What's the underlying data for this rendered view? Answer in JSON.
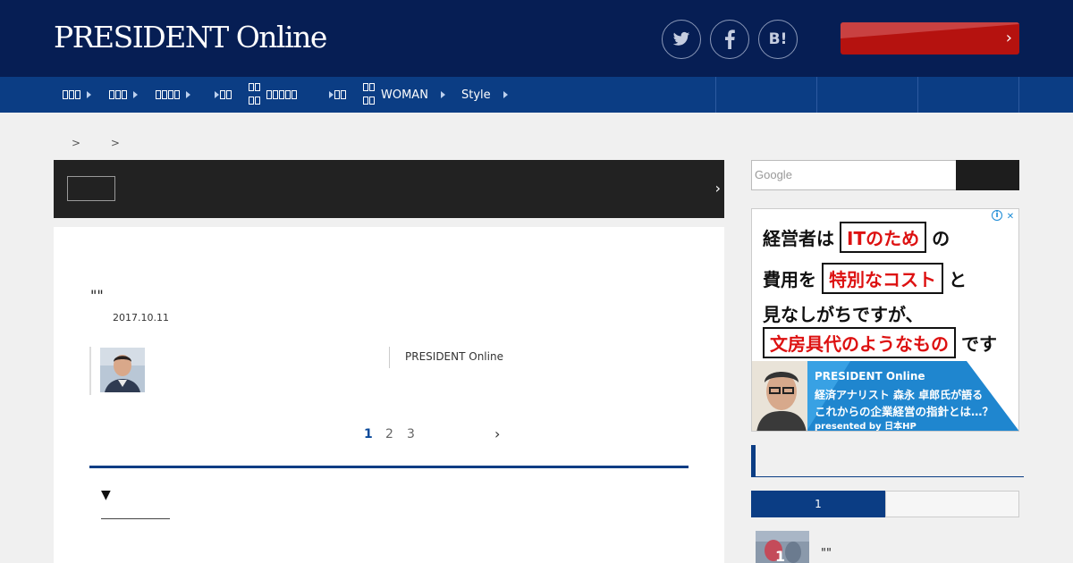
{
  "header": {
    "logo": "PRESIDENT Online",
    "social": {
      "twitter_icon": "twitter-icon",
      "facebook_icon": "facebook-icon",
      "hatena_label": "B!"
    },
    "promo_chevron": "›"
  },
  "nav": {
    "items": [
      {
        "label": "WOMAN"
      },
      {
        "label": "Style"
      }
    ]
  },
  "breadcrumb": {
    "sep1": ">",
    "sep2": ">"
  },
  "banner": {
    "chevron": "›"
  },
  "article": {
    "quote": "\"\"",
    "date": "2017.10.11",
    "source": "PRESIDENT Online",
    "pages": [
      "1",
      "2",
      "3"
    ],
    "next": "›",
    "toc_marker": "▼"
  },
  "search": {
    "placeholder": "Google"
  },
  "ad": {
    "line1_pre": "経営者は",
    "line1_box": "ITのため",
    "line1_post": "の",
    "line2_pre": "費用を",
    "line2_box": "特別なコスト",
    "line2_post": "と",
    "line3": "見なしがちですが、",
    "line4_box": "文房具代のようなもの",
    "line4_post": "です",
    "bottom_brand": "PRESIDENT Online",
    "bottom_line1": "経済アナリスト 森永 卓郎氏が語る",
    "bottom_line2": "これからの企業経営の指針とは…？",
    "bottom_line3": "presented by 日本HP",
    "info_icon": "i",
    "close_icon": "✕"
  },
  "ranking": {
    "tab_active": "1",
    "rank_number": "1",
    "item_quote": "\"\""
  },
  "colors": {
    "navy": "#061e54",
    "nav_blue": "#0b3d84",
    "promo_red": "#b5120f",
    "ad_red": "#d11111"
  }
}
